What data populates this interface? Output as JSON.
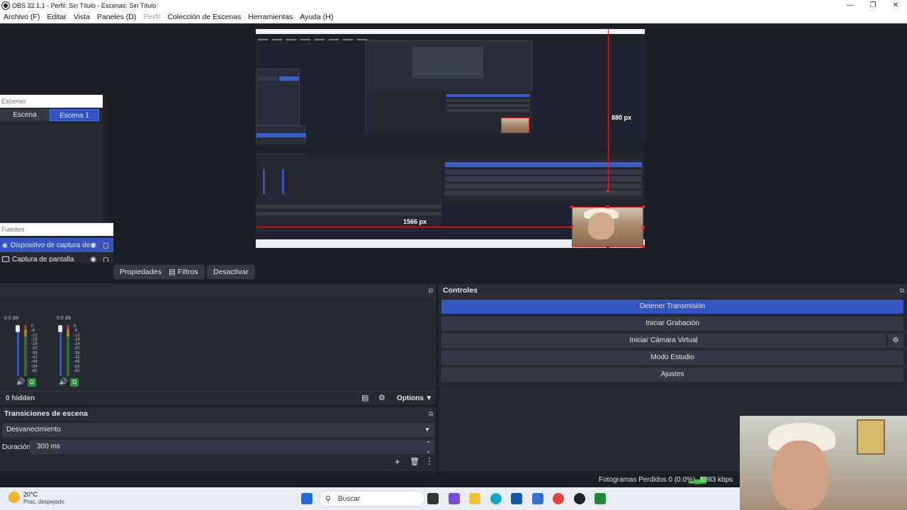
{
  "window": {
    "title": "OBS 32.1.1 - Perfil: Sin Título - Escenas: Sin Título"
  },
  "menu": [
    "Archivo (F)",
    "Editar",
    "Vista",
    "Paneles (D)",
    "Perfil",
    "Colección de Escenas",
    "Herramientas",
    "Ayuda (H)"
  ],
  "preview": {
    "width_label": "1566 px",
    "height_label": "880 px"
  },
  "scenes": {
    "title": "Escenas",
    "items": [
      "Escena",
      "Escena 1"
    ],
    "active": "Escena 1"
  },
  "sources": {
    "title": "Fuentes",
    "items": [
      {
        "label": "Dispositivo de captura de v",
        "selected": true
      },
      {
        "label": "Captura de pantalla",
        "selected": false
      }
    ]
  },
  "context": {
    "properties": "Propiedades",
    "filters": "Filtros",
    "deactivate": "Desactivar"
  },
  "mixer": {
    "channels": [
      {
        "db": "0.0 dB"
      },
      {
        "db": "0.0 dB"
      }
    ],
    "scale": [
      "0",
      "-6",
      "-12",
      "-18",
      "-24",
      "-30",
      "-36",
      "-42",
      "-48",
      "-54",
      "-60"
    ],
    "hidden": "0 hidden",
    "options": "Options"
  },
  "transitions": {
    "title": "Transiciones de escena",
    "type": "Desvanecimiento",
    "duration_label": "Duración",
    "duration_value": "300 ms"
  },
  "controls": {
    "title": "Controles",
    "stop_stream": "Detener Transmisión",
    "start_recording": "Iniciar Grabación",
    "start_virtualcam": "Iniciar Cámara Virtual",
    "studio_mode": "Modo Estudio",
    "settings": "Ajustes"
  },
  "status": {
    "dropped": "Fotogramas Perdidos 0 (0.0%)",
    "bitrate": "5983 kbps"
  },
  "taskbar": {
    "temp": "20°C",
    "weather": "Prac. despejado",
    "search": "Buscar"
  },
  "colors": {
    "accent": "#3355c2",
    "guide": "#e62020",
    "panel": "#272a33",
    "bg": "#1d1f26"
  }
}
